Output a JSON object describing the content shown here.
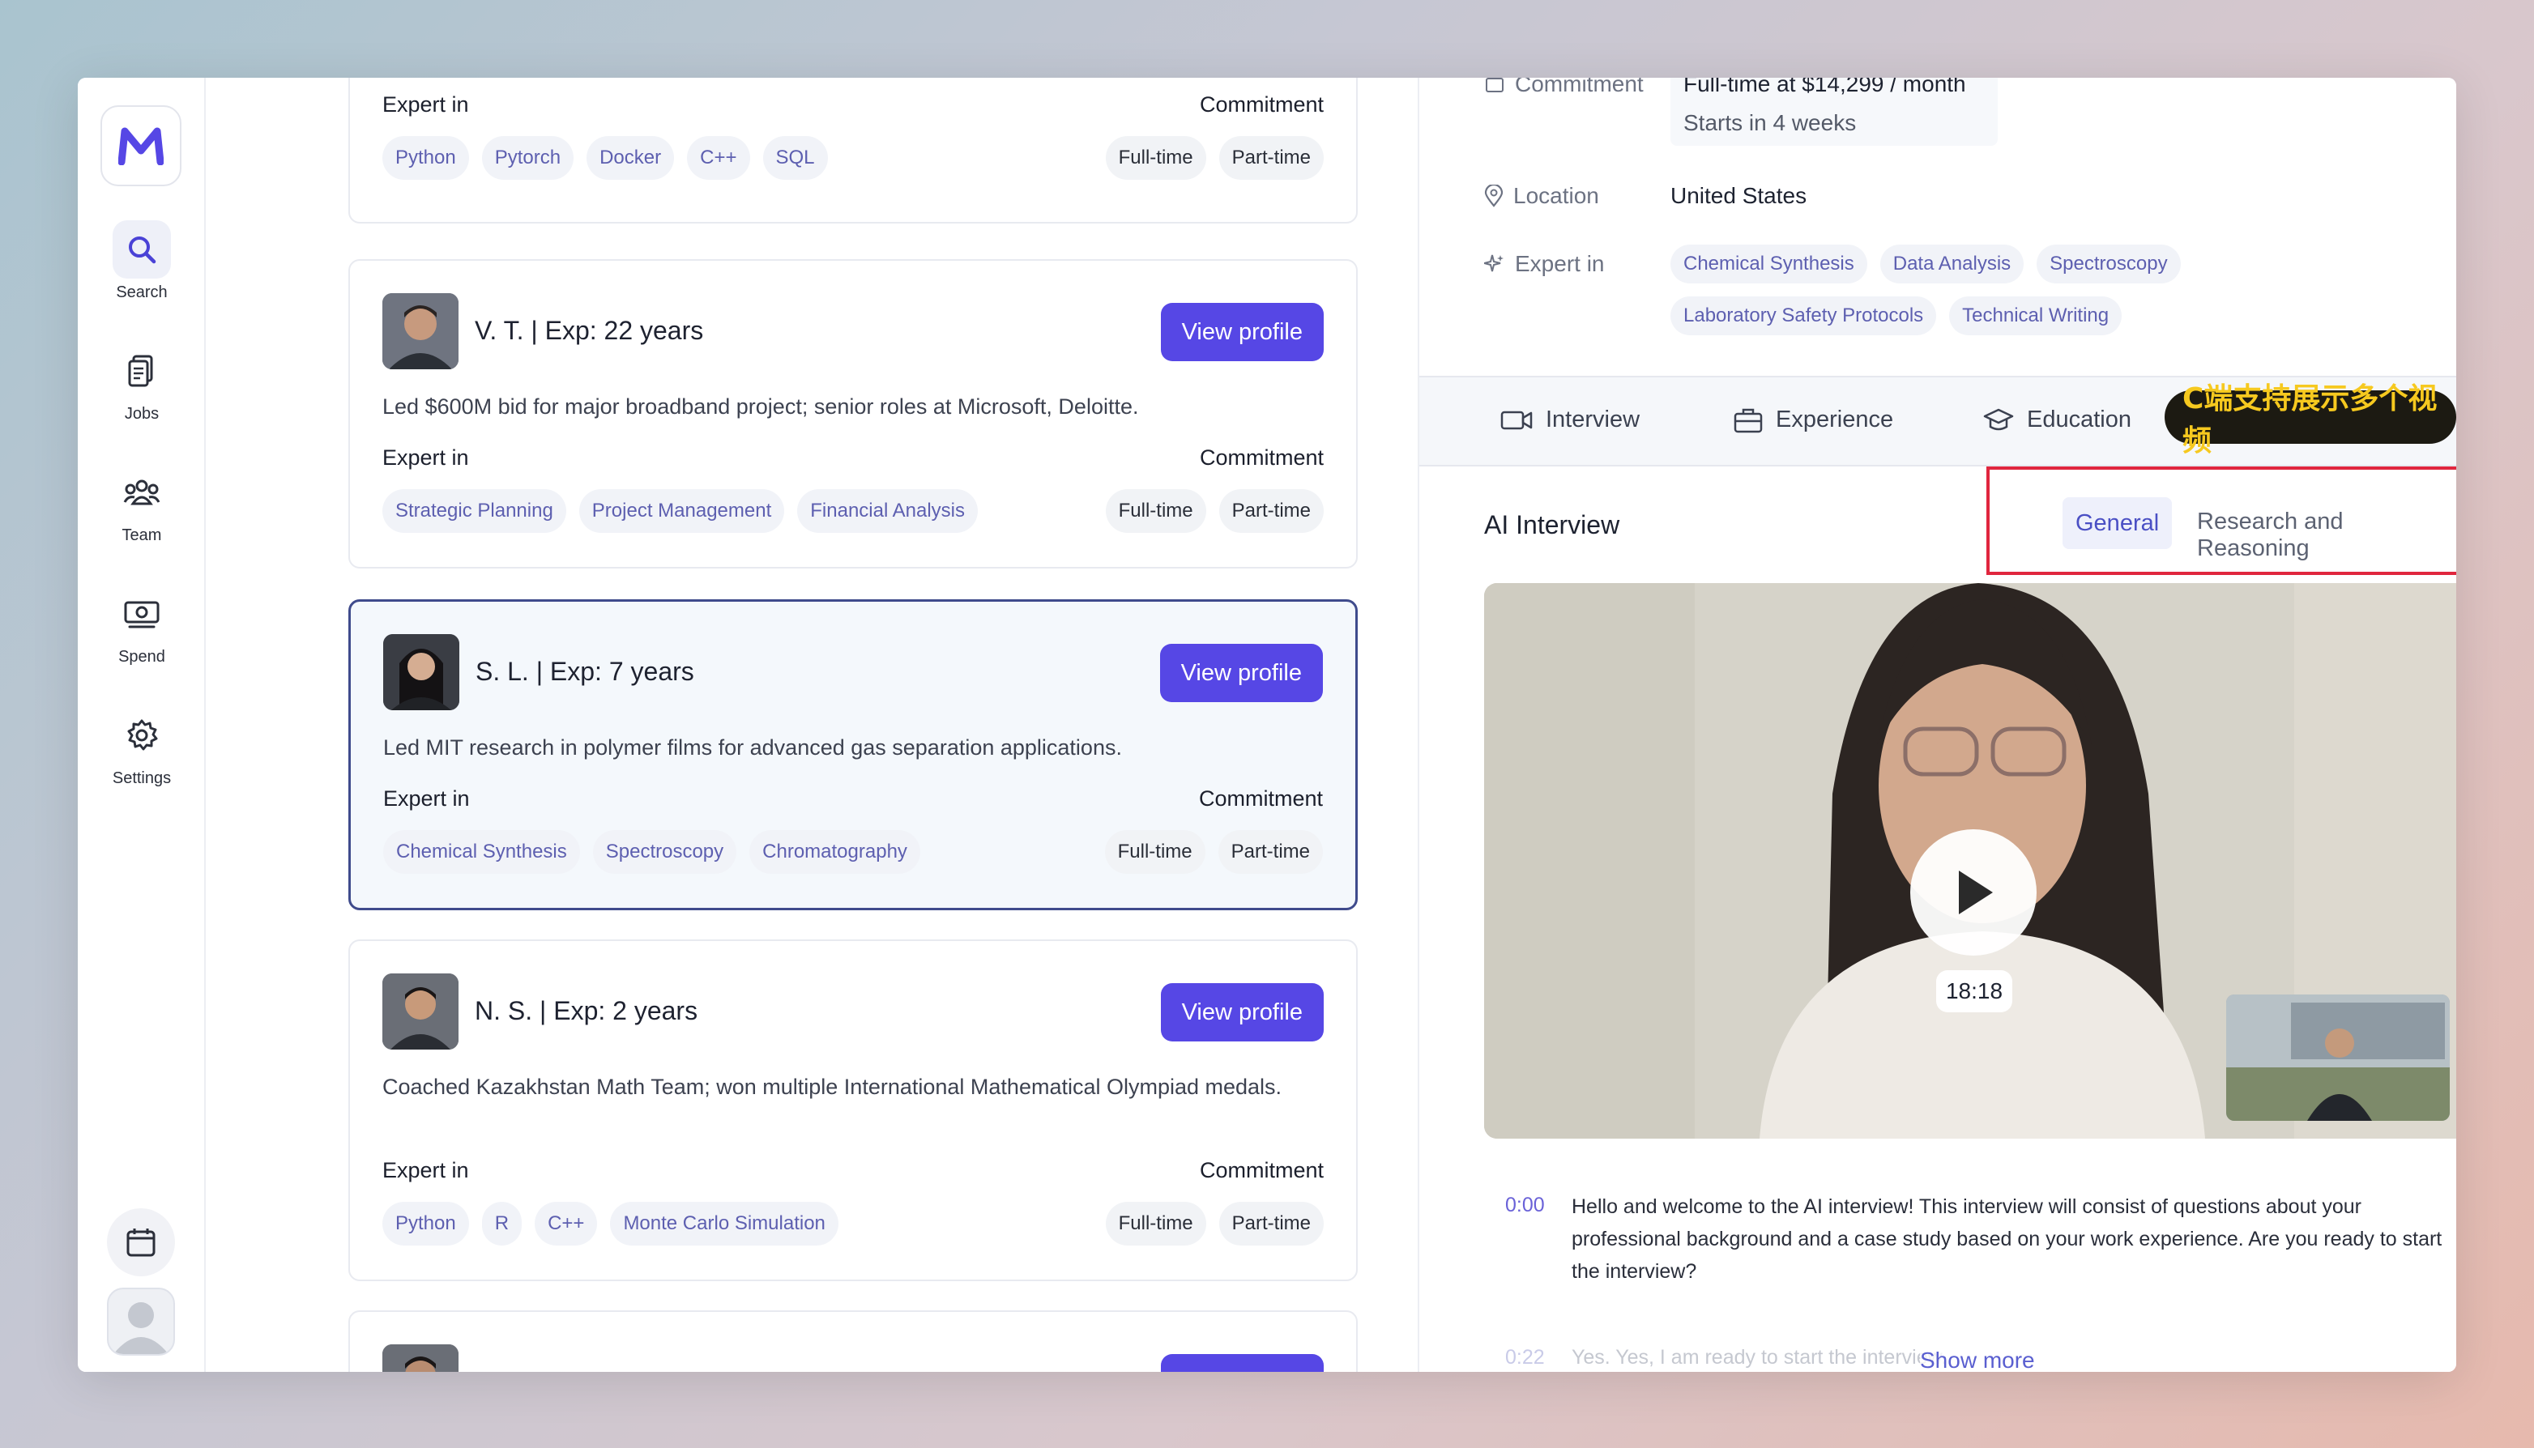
{
  "sidebar": {
    "items": [
      {
        "label": "Search",
        "icon": "search-icon"
      },
      {
        "label": "Jobs",
        "icon": "clipboard-icon"
      },
      {
        "label": "Team",
        "icon": "team-icon"
      },
      {
        "label": "Spend",
        "icon": "money-icon"
      },
      {
        "label": "Settings",
        "icon": "gear-icon"
      }
    ],
    "logo_letter": "M",
    "accent": "#5647e5"
  },
  "labels": {
    "expert_in": "Expert in",
    "commitment": "Commitment",
    "view_profile": "View profile",
    "full_time": "Full-time",
    "part_time": "Part-time"
  },
  "cards": [
    {
      "name": "",
      "skills": [
        "Python",
        "Pytorch",
        "Docker",
        "C++",
        "SQL"
      ]
    },
    {
      "name": "V. T. | Exp: 22 years",
      "desc": "Led $600M bid for major broadband project; senior roles at Microsoft, Deloitte.",
      "skills": [
        "Strategic Planning",
        "Project Management",
        "Financial Analysis"
      ]
    },
    {
      "name": "S. L. | Exp: 7 years",
      "desc": "Led MIT research in polymer films for advanced gas separation applications.",
      "skills": [
        "Chemical Synthesis",
        "Spectroscopy",
        "Chromatography"
      ]
    },
    {
      "name": "N. S. | Exp: 2 years",
      "desc": "Coached Kazakhstan Math Team; won multiple International Mathematical Olympiad medals.",
      "skills": [
        "Python",
        "R",
        "C++",
        "Monte Carlo Simulation"
      ]
    }
  ],
  "detail": {
    "commitment_label": "Commitment",
    "commitment_value": "Full-time at $14,299 / month",
    "commitment_start": "Starts in 4 weeks",
    "location_label": "Location",
    "location_value": "United States",
    "expert_label": "Expert in",
    "skills_row1": [
      "Chemical Synthesis",
      "Data Analysis",
      "Spectroscopy"
    ],
    "skills_row2": [
      "Laboratory Safety Protocols",
      "Technical Writing"
    ],
    "tabs": [
      "Interview",
      "Experience",
      "Education"
    ],
    "badge": "C端支持展示多个视频",
    "ai_title": "AI Interview",
    "sub_tabs": [
      "General",
      "Research and Reasoning"
    ],
    "video_duration": "18:18",
    "transcript": [
      {
        "time": "0:00",
        "text": "Hello and welcome to the AI interview! This interview will consist of questions about your professional background and a case study based on your work experience. Are you ready to start the interview?"
      },
      {
        "time": "0:22",
        "text": "Yes. Yes, I am ready to start the interview."
      }
    ],
    "show_more": "Show more"
  }
}
